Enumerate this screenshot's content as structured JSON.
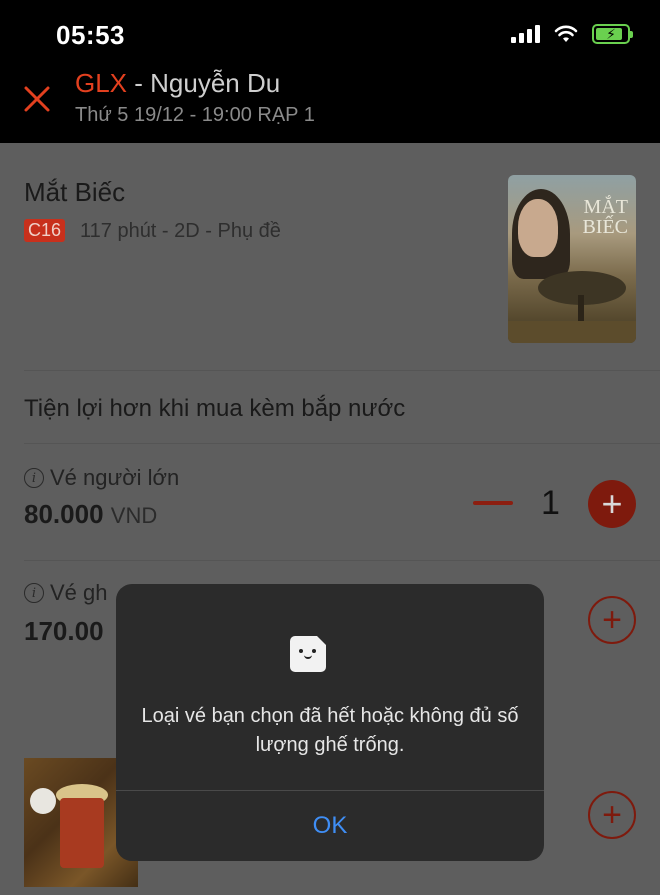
{
  "status_bar": {
    "time": "05:53"
  },
  "header": {
    "brand": "GLX",
    "cinema_suffix": " - Nguyễn Du",
    "showtime": "Thứ 5 19/12 - 19:00 RẠP 1"
  },
  "movie": {
    "title": "Mắt Biếc",
    "rating": "C16",
    "meta": "117 phút - 2D - Phụ đề",
    "poster_text": "MẮT BIẾC"
  },
  "promo_text": "Tiện lợi hơn khi mua kèm bắp nước",
  "tickets": [
    {
      "label": "Vé người lớn",
      "price": "80.000",
      "currency": "VND",
      "quantity": "1"
    },
    {
      "label": "Vé gh",
      "price": "170.00"
    }
  ],
  "alert": {
    "message": "Loại vé bạn chọn đã hết hoặc không đủ số lượng ghế trống.",
    "ok_label": "OK"
  },
  "colors": {
    "brand": "#e3401f",
    "accent_red": "#c8301c",
    "alert_ok": "#3f8ef5"
  }
}
